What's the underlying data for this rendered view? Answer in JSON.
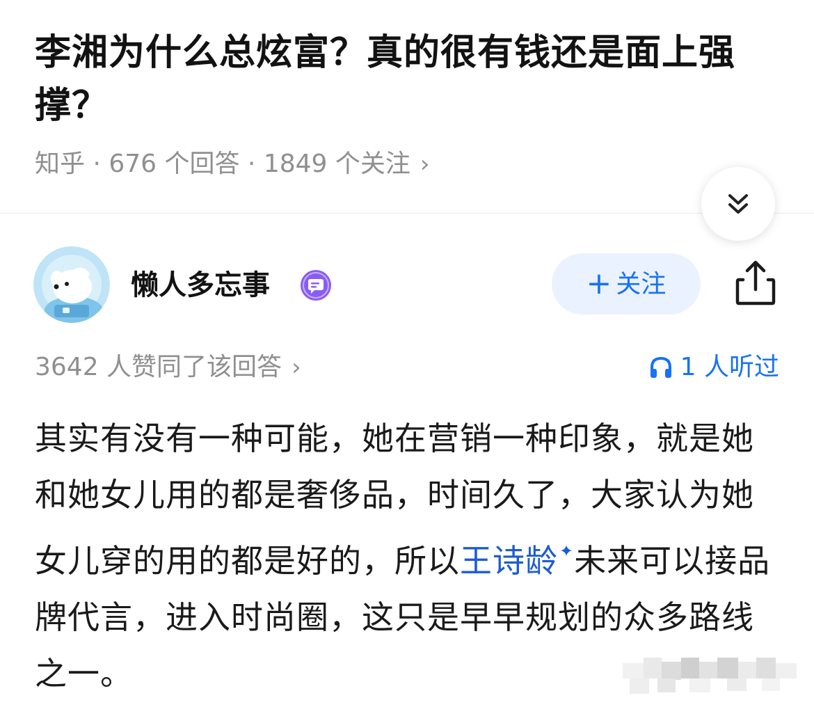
{
  "question": {
    "title": "李湘为什么总炫富？真的很有钱还是面上强撑？",
    "meta": "知乎 · 676 个回答 · 1849 个关注",
    "meta_chevron": "›"
  },
  "author": {
    "name": "懒人多忘事",
    "follow_plus": "+",
    "follow_label": "关注"
  },
  "stats": {
    "likes_text": "3642 人赞同了该回答",
    "likes_chevron": "›",
    "listen_text": "1 人听过"
  },
  "answer": {
    "text_before_link": "其实有没有一种可能，她在营销一种印象，就是她和她女儿用的都是奢侈品，时间久了，大家认为她女儿穿的用的都是好的，所以",
    "link_text": "王诗龄",
    "link_mark": "✦",
    "text_after_link": "未来可以接品牌代言，进入时尚圈，这只是早早规划的众多路线之一。"
  },
  "icons": {
    "collapse": "double-chevron-down-icon",
    "share": "share-icon",
    "badge": "message-badge-icon",
    "listen": "headphones-icon"
  },
  "colors": {
    "accent": "#1772f6",
    "follow_bg": "#eaf2ff",
    "meta_gray": "#8f8f8f",
    "badge_purple": "#8a5cf6",
    "link_blue": "#1d5bd4"
  }
}
